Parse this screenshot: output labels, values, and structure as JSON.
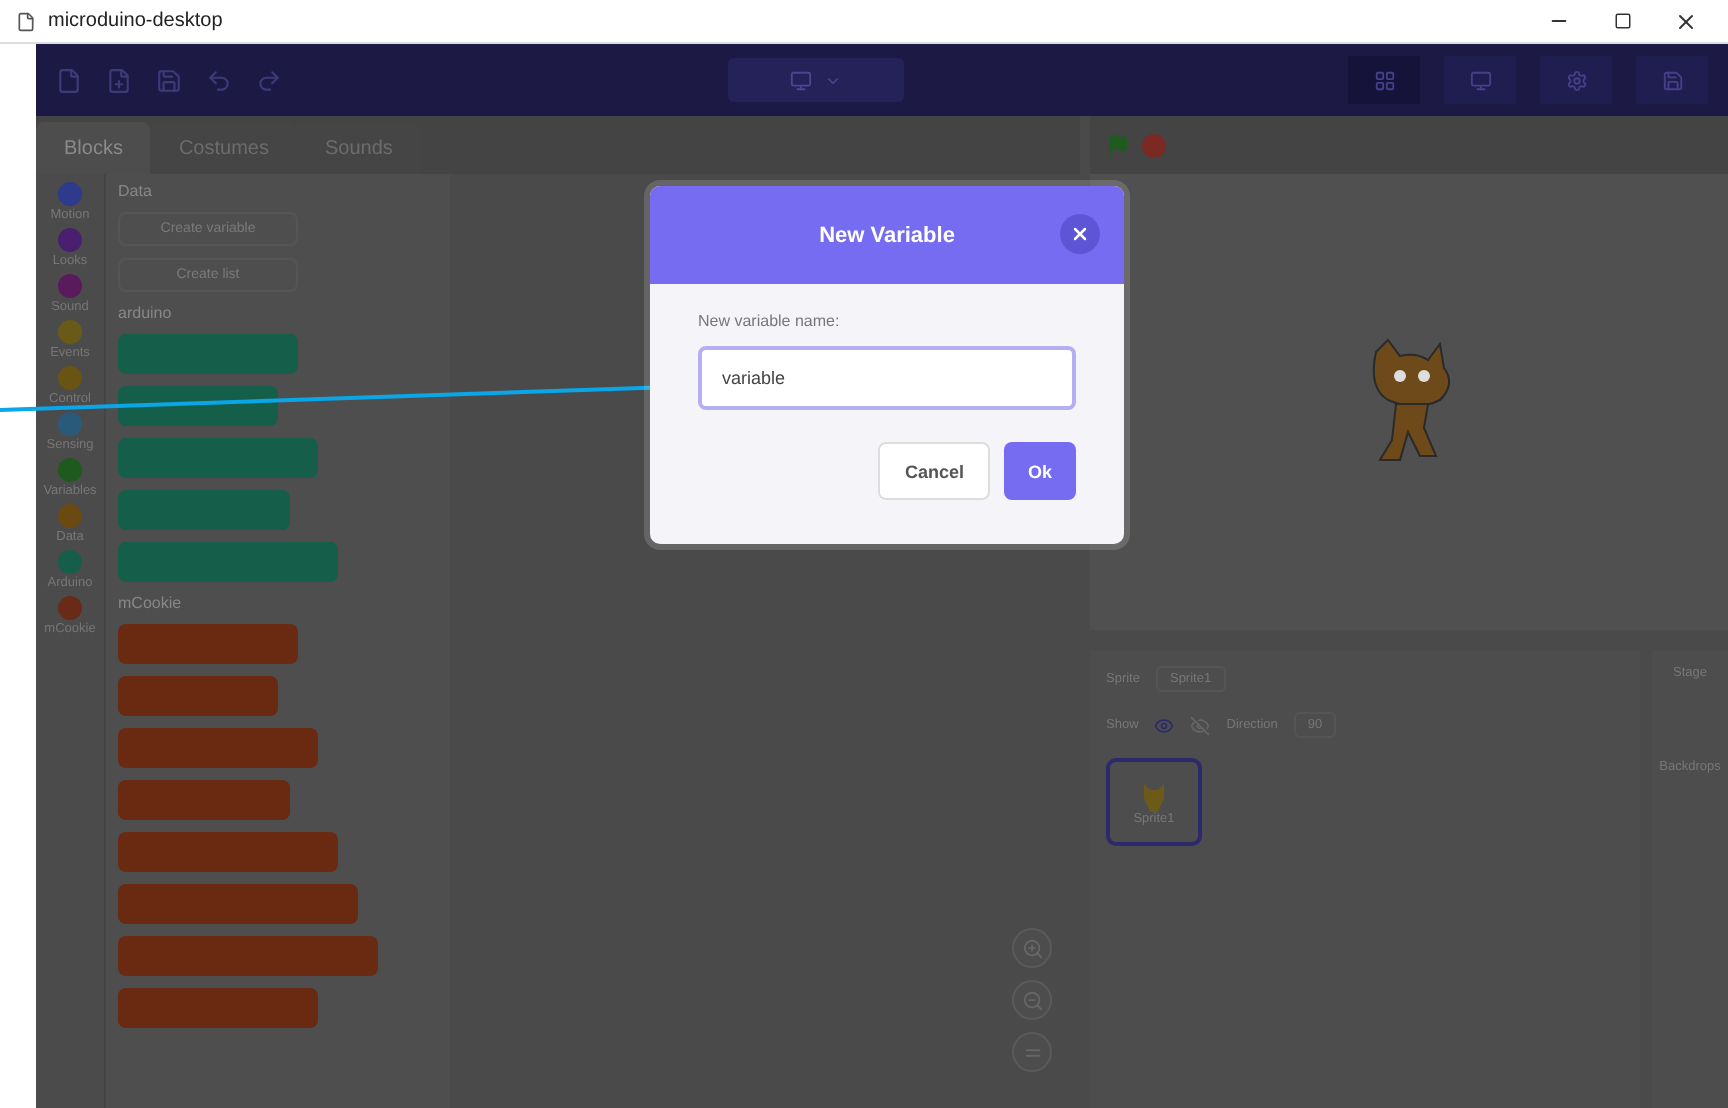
{
  "window": {
    "title": "microduino-desktop"
  },
  "tabs": [
    {
      "label": "Blocks",
      "selected": true
    },
    {
      "label": "Costumes",
      "selected": false
    },
    {
      "label": "Sounds",
      "selected": false
    }
  ],
  "categories": [
    {
      "label": "Motion",
      "color": "#2e3a8c"
    },
    {
      "label": "Looks",
      "color": "#4a1f70"
    },
    {
      "label": "Sound",
      "color": "#5a1a5e"
    },
    {
      "label": "Events",
      "color": "#6a5a18"
    },
    {
      "label": "Control",
      "color": "#6a5414"
    },
    {
      "label": "Sensing",
      "color": "#2a5a7a"
    },
    {
      "label": "Variables",
      "color": "#1d5a1d"
    },
    {
      "label": "Data",
      "color": "#6a4a10"
    },
    {
      "label": "Arduino",
      "color": "#155e4a"
    },
    {
      "label": "mCookie",
      "color": "#6a2a18"
    }
  ],
  "palette": [
    {
      "title": "Data",
      "kind": "buttons",
      "buttons": [
        "Create variable",
        "Create list"
      ]
    },
    {
      "title": "arduino",
      "kind": "blocks",
      "color": "#155e4a"
    },
    {
      "title": "mCookie",
      "kind": "blocks",
      "color": "#6a2a12"
    }
  ],
  "sprite_info": {
    "sprite_label": "Sprite",
    "sprite_name": "Sprite1",
    "show_label": "Show",
    "direction_label": "Direction",
    "direction_value": "90",
    "tile_name": "Sprite1"
  },
  "stage_pane": {
    "title": "Stage",
    "backdrops_label": "Backdrops"
  },
  "dialog": {
    "title": "New Variable",
    "field_label": "New variable name:",
    "value": "variable",
    "buttons": [
      {
        "label": "Cancel",
        "kind": "secondary"
      },
      {
        "label": "Ok",
        "kind": "primary"
      }
    ]
  }
}
